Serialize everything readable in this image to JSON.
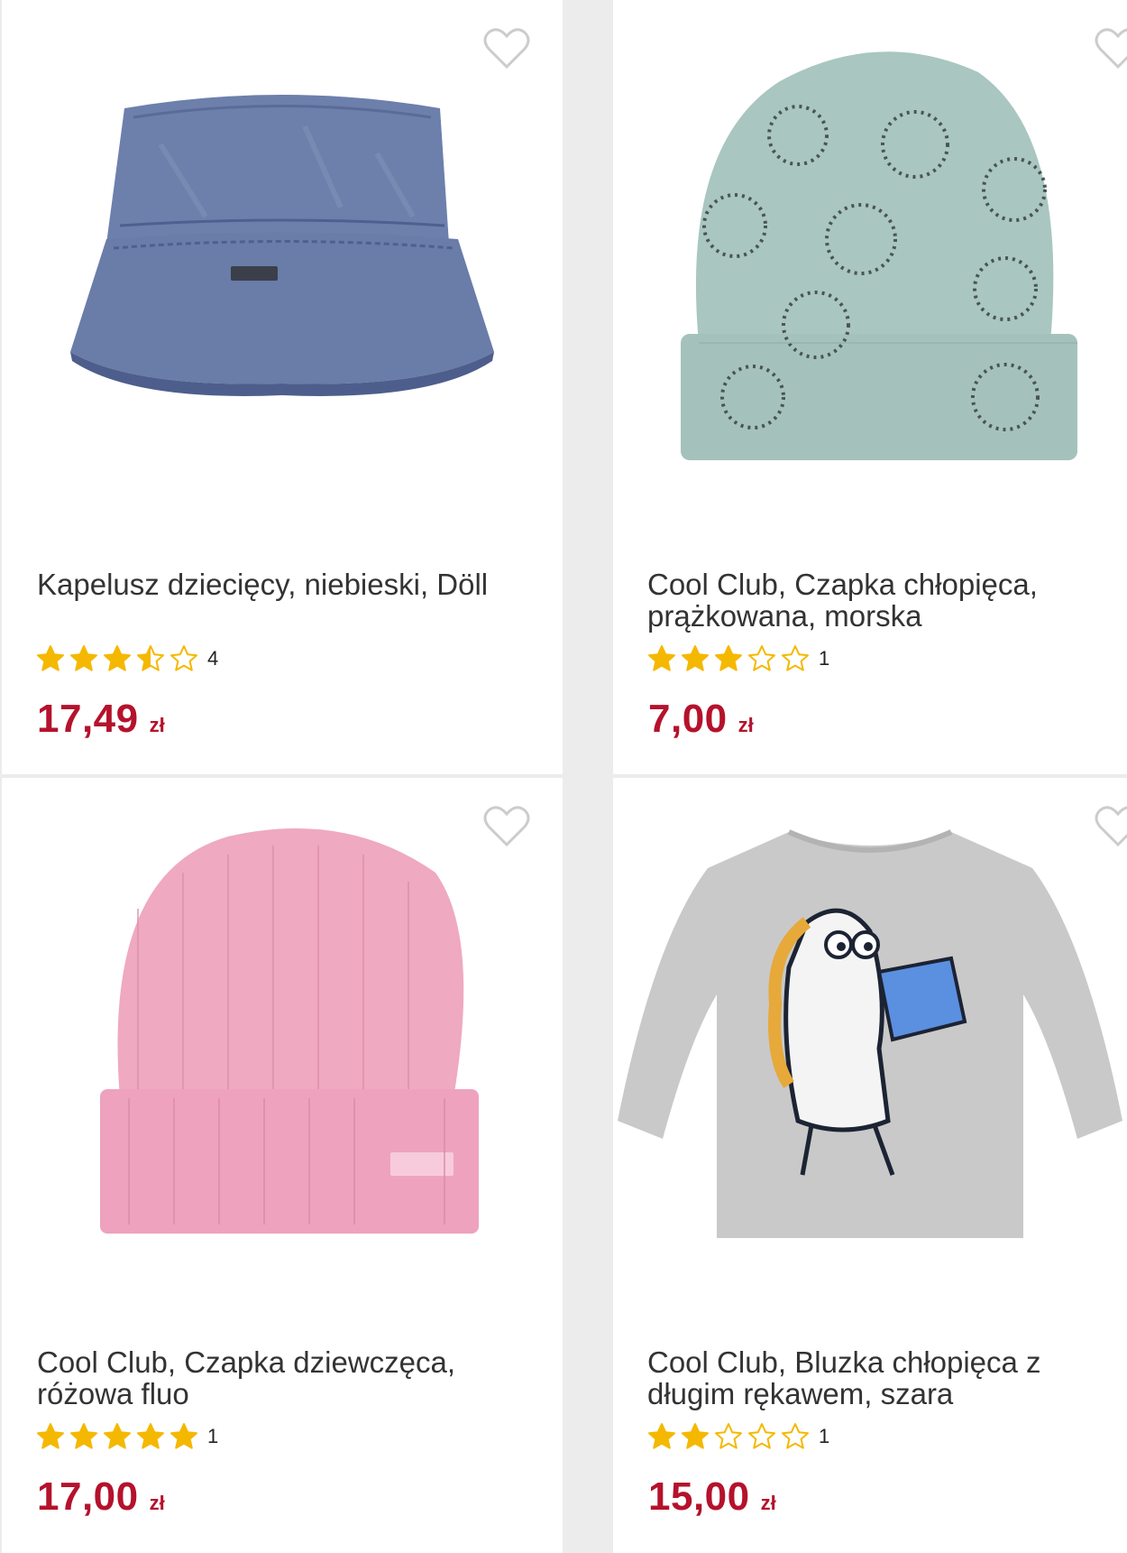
{
  "colors": {
    "background": "#ececec",
    "card": "#ffffff",
    "title_text": "#333333",
    "price": "#b5122c",
    "star_filled": "#f5b800",
    "star_empty_stroke": "#f5b800",
    "heart_stroke": "#cccccc"
  },
  "products": [
    {
      "image_icon": "bucket-hat-image",
      "title": "Kapelusz dziecięcy, niebieski, Döll",
      "rating": 3.5,
      "rating_max": 5,
      "review_count": "4",
      "price": "17,49",
      "currency": "zł"
    },
    {
      "image_icon": "beanie-mint-image",
      "title": "Cool Club, Czapka chłopięca, prążkowana, morska",
      "rating": 3,
      "rating_max": 5,
      "review_count": "1",
      "price": "7,00",
      "currency": "zł"
    },
    {
      "image_icon": "beanie-pink-image",
      "title": "Cool Club, Czapka dziewczęca, różowa fluo",
      "rating": 5,
      "rating_max": 5,
      "review_count": "1",
      "price": "17,00",
      "currency": "zł"
    },
    {
      "image_icon": "longsleeve-shirt-image",
      "title": "Cool Club, Bluzka chłopięca z długim rękawem, szara",
      "rating": 2,
      "rating_max": 5,
      "review_count": "1",
      "price": "15,00",
      "currency": "zł"
    }
  ]
}
